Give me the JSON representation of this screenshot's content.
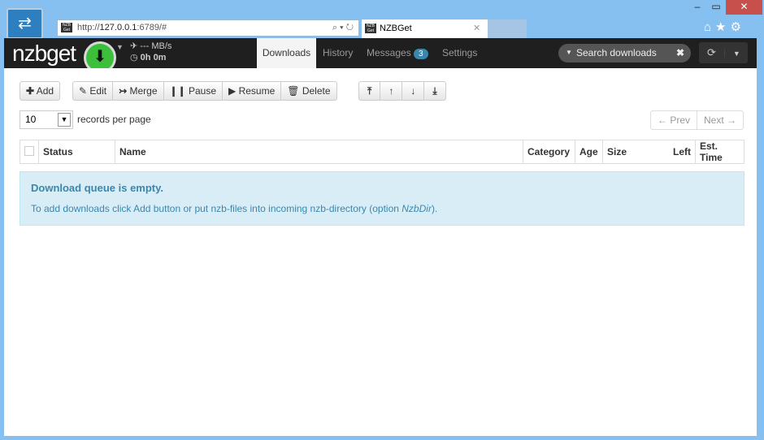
{
  "browser": {
    "url_prefix": "http://",
    "url_host": "127.0.0.1",
    "url_rest": ":6789/#",
    "tab_title": "NZBGet",
    "favicon": "NZB Get",
    "minimize": "–",
    "maximize": "▭",
    "close": "✕"
  },
  "nav": {
    "logo": "nzbget",
    "speed": "--- MB/s",
    "time": "0h 0m",
    "tabs": [
      {
        "label": "Downloads"
      },
      {
        "label": "History"
      },
      {
        "label": "Messages",
        "badge": "3"
      },
      {
        "label": "Settings"
      }
    ],
    "search_placeholder": "Search downloads"
  },
  "toolbar": {
    "add": "Add",
    "edit": "Edit",
    "merge": "Merge",
    "pause": "Pause",
    "resume": "Resume",
    "delete": "Delete"
  },
  "paging": {
    "records": "10",
    "records_label": "records per page",
    "prev": "← Prev",
    "next": "Next →"
  },
  "table": {
    "columns": [
      "Status",
      "Name",
      "Category",
      "Age",
      "Size",
      "Left",
      "Est. Time"
    ]
  },
  "alert": {
    "title": "Download queue is empty.",
    "text": "To add downloads click Add button or put nzb-files into incoming nzb-directory (option ",
    "option": "NzbDir",
    "text_end": ")."
  },
  "colors": {
    "accent": "#3cc03c",
    "navbar": "#1f1f1f",
    "info": "#3a87ad"
  }
}
